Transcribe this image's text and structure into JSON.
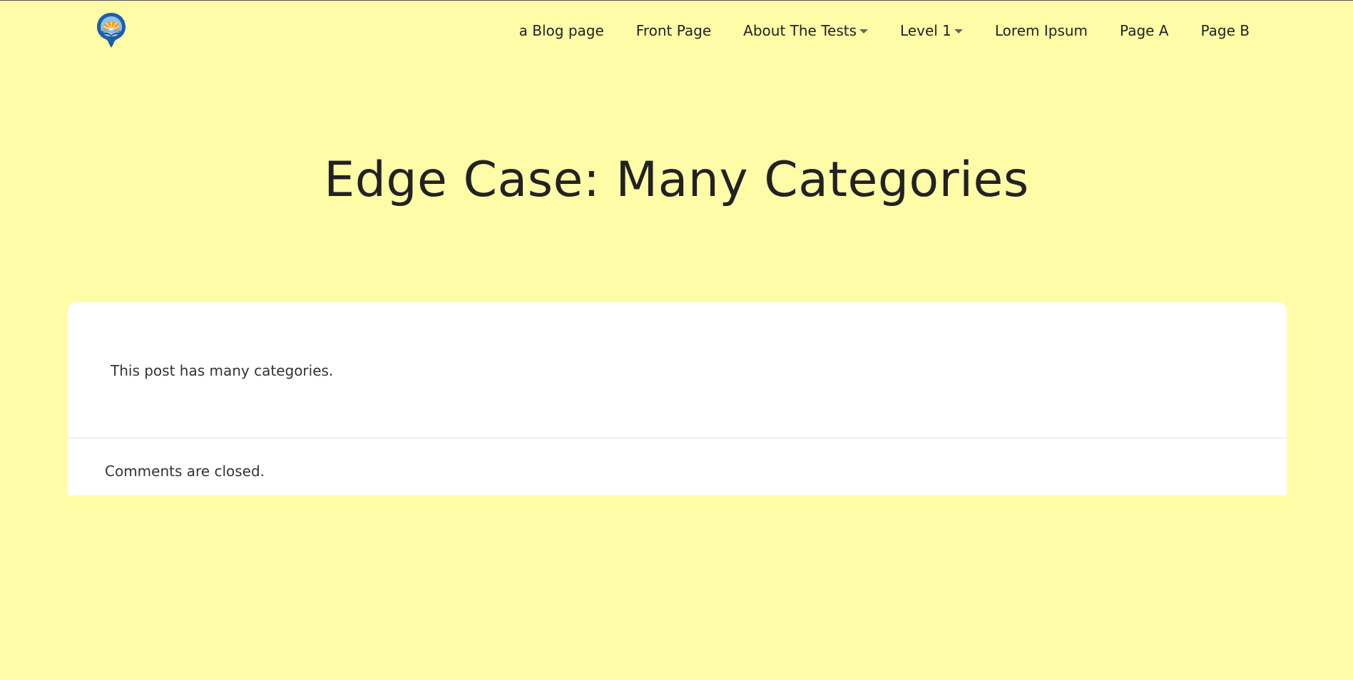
{
  "nav": {
    "items": [
      {
        "label": "a Blog page",
        "dropdown": false
      },
      {
        "label": "Front Page",
        "dropdown": false
      },
      {
        "label": "About The Tests",
        "dropdown": true
      },
      {
        "label": "Level 1",
        "dropdown": true
      },
      {
        "label": "Lorem Ipsum",
        "dropdown": false
      },
      {
        "label": "Page A",
        "dropdown": false
      },
      {
        "label": "Page B",
        "dropdown": false
      }
    ]
  },
  "page": {
    "title": "Edge Case: Many Categories"
  },
  "post": {
    "content": "This post has many categories.",
    "comments_status": "Comments are closed."
  },
  "colors": {
    "background": "#fffca8",
    "card": "#ffffff",
    "text": "#222222",
    "logo_blue": "#1f5fa8",
    "logo_orange": "#f2a01e"
  },
  "icons": {
    "logo": "site-logo-icon",
    "caret": "chevron-down-icon"
  }
}
